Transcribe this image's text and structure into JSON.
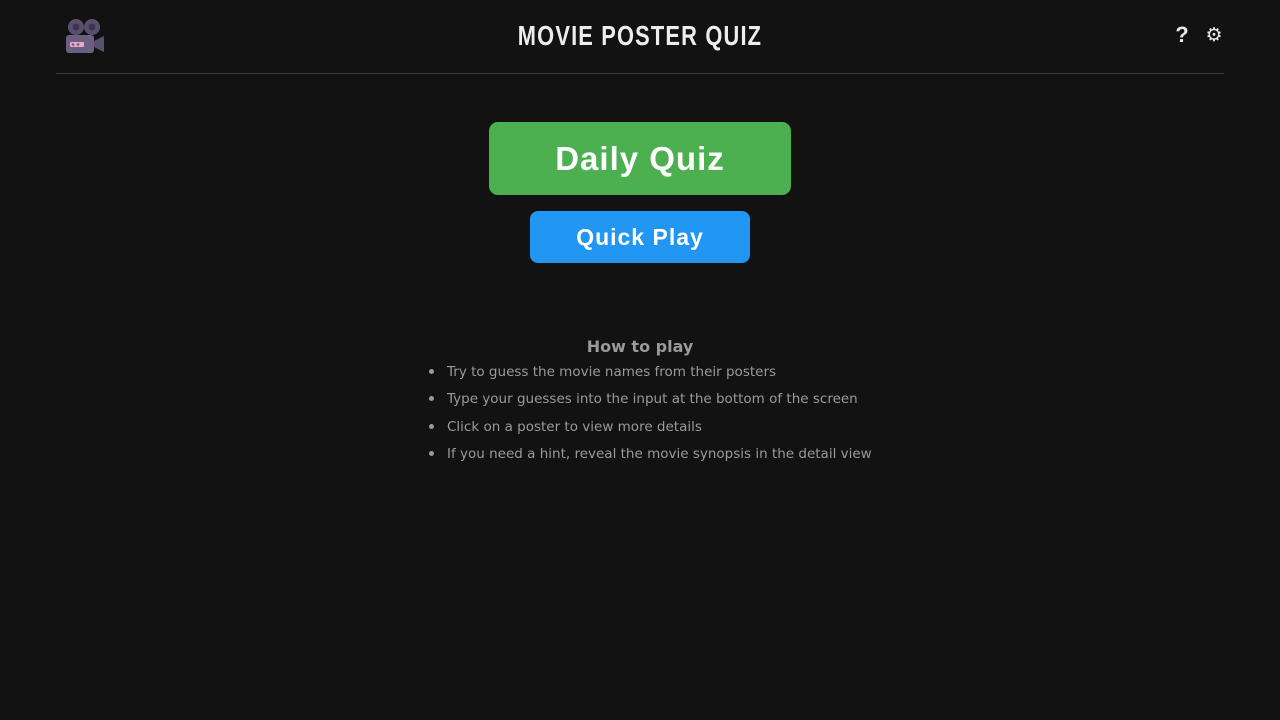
{
  "header": {
    "title": "MOVIE POSTER QUIZ",
    "logo_icon": "movie-camera-icon",
    "help_label": "?",
    "settings_label": "⚙"
  },
  "main": {
    "daily_quiz_label": "Daily Quiz",
    "quick_play_label": "Quick Play"
  },
  "how_to_play": {
    "title": "How to play",
    "rules": [
      "Try to guess the movie names from their posters",
      "Type your guesses into the input at the bottom of the screen",
      "Click on a poster to view more details",
      "If you need a hint, reveal the movie synopsis in the detail view"
    ]
  },
  "colors": {
    "background": "#121212",
    "daily_quiz": "#4caf50",
    "quick_play": "#2196f3",
    "text_muted": "#9a9a9a"
  }
}
